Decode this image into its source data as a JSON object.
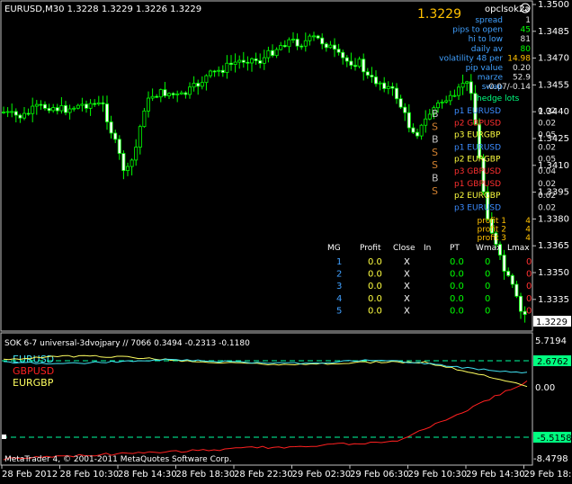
{
  "header": {
    "symbol_line": "EURUSD,M30  1.3228 1.3229 1.3226 1.3229",
    "big_price": "1.3229",
    "ea_name": "opclsok2a",
    "ea_icon": "smiley-icon"
  },
  "info_panel": [
    {
      "label": "spread",
      "value": "1"
    },
    {
      "label": "pips to open",
      "value": "45"
    },
    {
      "label": "hi to low",
      "value": "81"
    },
    {
      "label": "daily av",
      "value": "80"
    },
    {
      "label": "volatility 48 per",
      "value": "14.98"
    },
    {
      "label": "pip value",
      "value": "0.20"
    },
    {
      "label": "marze",
      "value": "52.9"
    },
    {
      "label": "swap",
      "value": "-0.07/-0.14"
    }
  ],
  "hedge_lots_title": "hedge lots",
  "hedge_groups": [
    [
      {
        "id": "p1",
        "pair": "EURUSD",
        "lots": "0.02",
        "color": "#3c8cff"
      },
      {
        "id": "p2",
        "pair": "GBPUSD",
        "lots": "0.02",
        "color": "#ff3030"
      },
      {
        "id": "p3",
        "pair": "EURGBP",
        "lots": "0.05",
        "color": "#ffff40"
      }
    ],
    [
      {
        "id": "p1",
        "pair": "EURUSD",
        "lots": "0.02",
        "color": "#3c8cff"
      },
      {
        "id": "p2",
        "pair": "EURGBP",
        "lots": "0.05",
        "color": "#ffff40"
      },
      {
        "id": "p3",
        "pair": "GBPUSD",
        "lots": "0.04",
        "color": "#ff3030"
      }
    ],
    [
      {
        "id": "p1",
        "pair": "GBPUSD",
        "lots": "0.02",
        "color": "#ff3030"
      },
      {
        "id": "p2",
        "pair": "EURGBP",
        "lots": "0.02",
        "color": "#ffff40"
      },
      {
        "id": "p3",
        "pair": "EURUSD",
        "lots": "0.02",
        "color": "#3c8cff"
      }
    ]
  ],
  "bs_markers": [
    {
      "letter": "B",
      "color": "#c0c0c0"
    },
    {
      "letter": "S",
      "color": "#d08030"
    },
    {
      "letter": "B",
      "color": "#c0c0c0"
    },
    {
      "letter": "S",
      "color": "#d08030"
    },
    {
      "letter": "S",
      "color": "#d08030"
    },
    {
      "letter": "B",
      "color": "#c0c0c0"
    },
    {
      "letter": "S",
      "color": "#d08030"
    }
  ],
  "profit_targets": [
    {
      "label": "profit 1",
      "value": "4"
    },
    {
      "label": "profit 2",
      "value": "4"
    },
    {
      "label": "profit 3",
      "value": "4"
    }
  ],
  "mg_table": {
    "headers": [
      "MG",
      "Profit",
      "Close",
      "In",
      "PT",
      "Wmax",
      "Lmax"
    ],
    "rows": [
      [
        "1",
        "0.0",
        "X",
        "",
        "0.0",
        "0",
        "0"
      ],
      [
        "2",
        "0.0",
        "X",
        "",
        "0.0",
        "0",
        "0"
      ],
      [
        "3",
        "0.0",
        "X",
        "",
        "0.0",
        "0",
        "0"
      ],
      [
        "4",
        "0.0",
        "X",
        "",
        "0.0",
        "0",
        "0"
      ],
      [
        "5",
        "0.0",
        "X",
        "",
        "0.0",
        "0",
        "0"
      ]
    ]
  },
  "price_axis": [
    "1.3500",
    "1.3485",
    "1.3470",
    "1.3455",
    "1.3440",
    "1.3425",
    "1.3410",
    "1.3395",
    "1.3380",
    "1.3365",
    "1.3350",
    "1.3335"
  ],
  "current_price_tag": "1.3229",
  "indicator": {
    "title": "SOK 6-7 universal-3dvojpary  // 7066 0.3494 -0.2313 -0.1180",
    "legend": [
      {
        "label": "EURUSD",
        "color": "#40e0f0"
      },
      {
        "label": "GBPUSD",
        "color": "#ff2020"
      },
      {
        "label": "EURGBP",
        "color": "#ffff60"
      }
    ],
    "axis_top": "5.7194",
    "axis_zero": "0.00",
    "axis_bottom": "-8.4798",
    "upper_level": "2.6762",
    "lower_level": "-5.5158"
  },
  "copyright": "MetaTrader 4, © 2001-2011 MetaQuotes Software Corp.",
  "time_axis": [
    "28 Feb 2012",
    "28 Feb 10:30",
    "28 Feb 14:30",
    "28 Feb 18:30",
    "28 Feb 22:30",
    "29 Feb 02:30",
    "29 Feb 06:30",
    "29 Feb 10:30",
    "29 Feb 14:30",
    "29 Feb 18:30"
  ],
  "colors": {
    "candle": "#00ff00",
    "background": "#000000",
    "grid": "#808080",
    "axis_text": "#ffffff"
  }
}
